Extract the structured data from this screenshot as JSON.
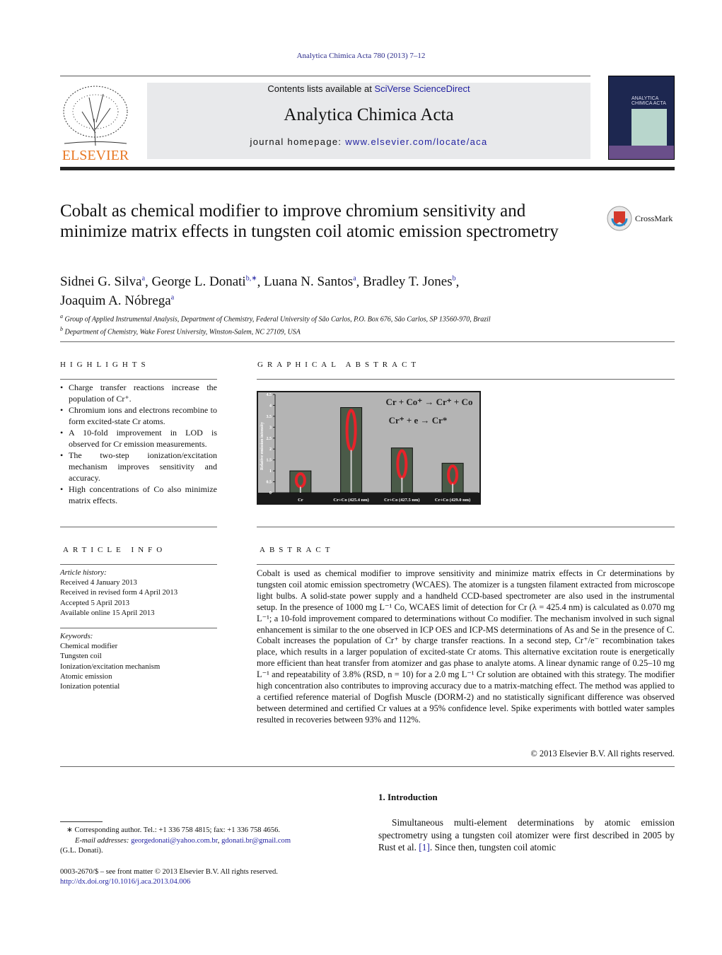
{
  "header": {
    "journal_ref": "Analytica Chimica Acta 780 (2013) 7–12",
    "contents_prefix": "Contents lists available at ",
    "contents_link": "SciVerse ScienceDirect",
    "journal_title": "Analytica Chimica Acta",
    "homepage_prefix": "journal homepage: ",
    "homepage_link": "www.elsevier.com/locate/aca",
    "publisher_logo": "ELSEVIER",
    "cover_title": "ANALYTICA CHIMICA ACTA"
  },
  "article": {
    "title": "Cobalt as chemical modifier to improve chromium sensitivity and minimize matrix effects in tungsten coil atomic emission spectrometry",
    "crossmark": "CrossMark",
    "authors": [
      {
        "name": "Sidnei G. Silva",
        "aff": "a"
      },
      {
        "name": "George L. Donati",
        "aff": "b,∗"
      },
      {
        "name": "Luana N. Santos",
        "aff": "a"
      },
      {
        "name": "Bradley T. Jones",
        "aff": "b"
      },
      {
        "name": "Joaquim A. Nóbrega",
        "aff": "a"
      }
    ],
    "affiliations": [
      {
        "mark": "a",
        "text": "Group of Applied Instrumental Analysis, Department of Chemistry, Federal University of São Carlos, P.O. Box 676, São Carlos, SP 13560-970, Brazil"
      },
      {
        "mark": "b",
        "text": "Department of Chemistry, Wake Forest University, Winston-Salem, NC 27109, USA"
      }
    ]
  },
  "highlights": {
    "heading": "HIGHLIGHTS",
    "items": [
      "Charge transfer reactions increase the population of Cr⁺.",
      "Chromium ions and electrons recombine to form excited-state Cr atoms.",
      "A 10-fold improvement in LOD is observed for Cr emission measurements.",
      "The two-step ionization/excitation mechanism improves sensitivity and accuracy.",
      "High concentrations of Co also minimize matrix effects."
    ]
  },
  "graphical_abstract": {
    "heading": "GRAPHICAL ABSTRACT"
  },
  "chart_data": {
    "type": "bar",
    "categories": [
      "Cr",
      "Cr+Co (425.4 nm)",
      "Cr+Co (427.5 nm)",
      "Cr+Co (429.0 nm)"
    ],
    "values": [
      1.0,
      3.9,
      2.05,
      1.35
    ],
    "ylabel": "Relative emission intensity",
    "xlabel": "",
    "ylim": [
      0,
      4.5
    ],
    "yticks": [
      "0",
      "0.5",
      "1",
      "1.5",
      "2",
      "2.5",
      "3",
      "3.5",
      "4",
      "4.5"
    ],
    "annotations": [
      "Cr + Co⁺ → Cr⁺ + Co",
      "Cr⁺ + e → Cr*"
    ],
    "grid": false,
    "background": "#b4b4b4"
  },
  "article_info": {
    "heading": "ARTICLE INFO",
    "history_label": "Article history:",
    "history": [
      "Received 4 January 2013",
      "Received in revised form 4 April 2013",
      "Accepted 5 April 2013",
      "Available online 15 April 2013"
    ],
    "keywords_label": "Keywords:",
    "keywords": [
      "Chemical modifier",
      "Tungsten coil",
      "Ionization/excitation mechanism",
      "Atomic emission",
      "Ionization potential"
    ]
  },
  "abstract": {
    "heading": "ABSTRACT",
    "text": "Cobalt is used as chemical modifier to improve sensitivity and minimize matrix effects in Cr determinations by tungsten coil atomic emission spectrometry (WCAES). The atomizer is a tungsten filament extracted from microscope light bulbs. A solid-state power supply and a handheld CCD-based spectrometer are also used in the instrumental setup. In the presence of 1000 mg L⁻¹ Co, WCAES limit of detection for Cr (λ = 425.4 nm) is calculated as 0.070 mg L⁻¹; a 10-fold improvement compared to determinations without Co modifier. The mechanism involved in such signal enhancement is similar to the one observed in ICP OES and ICP-MS determinations of As and Se in the presence of C. Cobalt increases the population of Cr⁺ by charge transfer reactions. In a second step, Cr⁺/e⁻ recombination takes place, which results in a larger population of excited-state Cr atoms. This alternative excitation route is energetically more efficient than heat transfer from atomizer and gas phase to analyte atoms. A linear dynamic range of 0.25–10 mg L⁻¹ and repeatability of 3.8% (RSD, n = 10) for a 2.0 mg L⁻¹ Cr solution are obtained with this strategy. The modifier high concentration also contributes to improving accuracy due to a matrix-matching effect. The method was applied to a certified reference material of Dogfish Muscle (DORM-2) and no statistically significant difference was observed between determined and certified Cr values at a 95% confidence level. Spike experiments with bottled water samples resulted in recoveries between 93% and 112%.",
    "copyright": "© 2013 Elsevier B.V. All rights reserved."
  },
  "introduction": {
    "heading": "1.  Introduction",
    "text_before": "Simultaneous multi-element determinations by atomic emission spectrometry using a tungsten coil atomizer were first described in 2005 by Rust et al. ",
    "ref": "[1]",
    "text_after": ". Since then, tungsten coil atomic"
  },
  "footnotes": {
    "corresponding": "∗ Corresponding author. Tel.: +1 336 758 4815; fax: +1 336 758 4656.",
    "email_label": "E-mail addresses: ",
    "email1": "georgedonati@yahoo.com.br",
    "email_sep": ", ",
    "email2": "gdonati.br@gmail.com",
    "email_owner": "(G.L. Donati).",
    "front_matter": "0003-2670/$ – see front matter © 2013 Elsevier B.V. All rights reserved.",
    "doi": "http://dx.doi.org/10.1016/j.aca.2013.04.006"
  }
}
